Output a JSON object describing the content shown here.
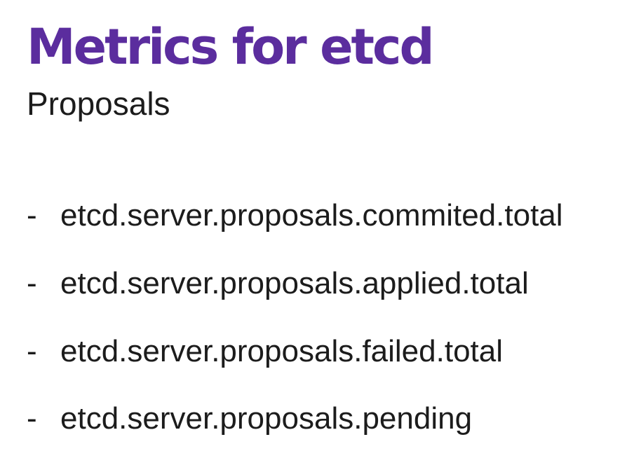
{
  "colors": {
    "accent": "#5b2d9e",
    "text": "#1c1c1c",
    "background": "#ffffff"
  },
  "slide": {
    "title": "Metrics for etcd",
    "subtitle": "Proposals",
    "bullet_glyph": "-",
    "items": [
      "etcd.server.proposals.commited.total",
      "etcd.server.proposals.applied.total",
      "etcd.server.proposals.failed.total",
      "etcd.server.proposals.pending"
    ]
  }
}
